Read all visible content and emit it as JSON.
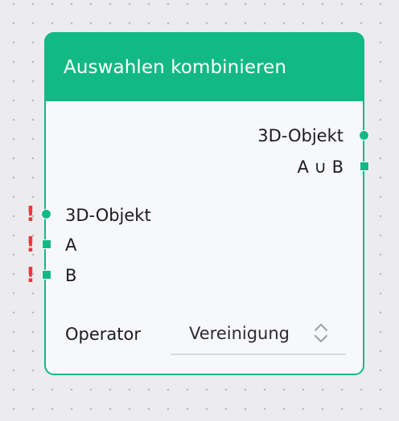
{
  "node": {
    "title": "Auswahlen kombinieren",
    "outputs": [
      {
        "label": "3D-Objekt",
        "socket": "circle"
      },
      {
        "label": "A ∪ B",
        "socket": "square"
      }
    ],
    "inputs": [
      {
        "label": "3D-Objekt",
        "socket": "circle",
        "warning": "!"
      },
      {
        "label": "A",
        "socket": "square",
        "warning": "!"
      },
      {
        "label": "B",
        "socket": "square",
        "warning": "!"
      }
    ],
    "operator": {
      "label": "Operator",
      "value": "Vereinigung",
      "icon": "chevron-up-down-icon"
    }
  },
  "colors": {
    "accent": "#13b983",
    "warning": "#e83a3a",
    "background": "#ececef",
    "node_body": "#f7f8fa"
  }
}
